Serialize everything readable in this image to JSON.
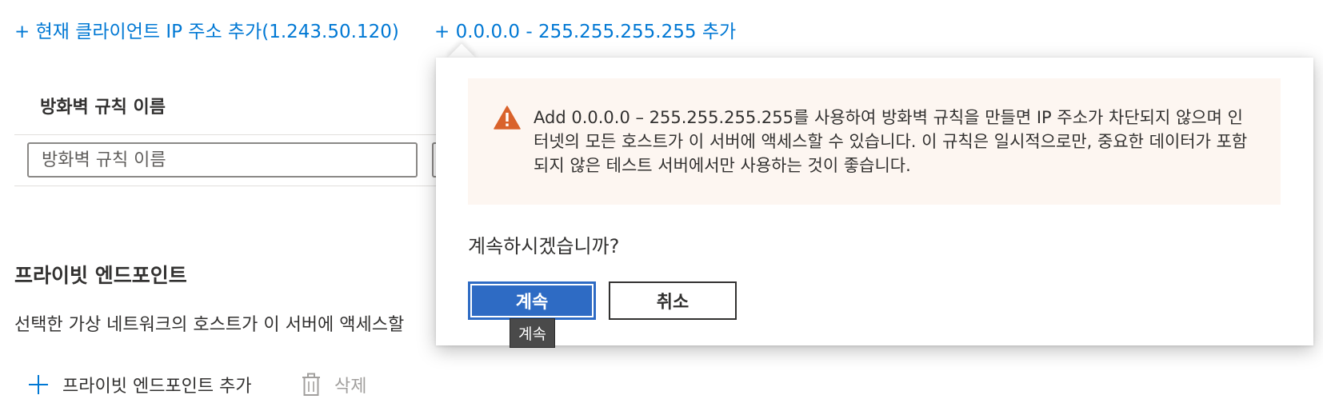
{
  "links": {
    "add_client_ip": "+ 현재 클라이언트 IP 주소 추가(1.243.50.120)",
    "add_all_range": "+ 0.0.0.0 - 255.255.255.255 추가"
  },
  "firewall_table": {
    "column_header": "방화벽 규칙 이름",
    "name_input_placeholder": "방화벽 규칙 이름",
    "name_input_value": ""
  },
  "private_endpoints": {
    "title": "프라이빗 엔드포인트",
    "description": "선택한 가상 네트워크의 호스트가 이 서버에 액세스할",
    "add_label": "프라이빗 엔드포인트 추가",
    "delete_label": "삭제",
    "add_icon": "plus-icon",
    "delete_icon": "trash-icon"
  },
  "dialog": {
    "warning_icon": "warning-icon",
    "warning_text": "Add 0.0.0.0 – 255.255.255.255를 사용하여 방화벽 규칙을 만들면 IP 주소가 차단되지 않으며 인터넷의 모든 호스트가 이 서버에 액세스할 수 있습니다. 이 규칙은 일시적으로만, 중요한 데이터가 포함되지 않은 테스트 서버에서만 사용하는 것이 좋습니다.",
    "prompt": "계속하시겠습니까?",
    "continue_label": "계속",
    "cancel_label": "취소",
    "tooltip": "계속"
  },
  "colors": {
    "link": "#0078d4",
    "primary_button": "#2e6bc4",
    "warning_background": "#fdf6f1",
    "warning_icon": "#d9622b"
  }
}
